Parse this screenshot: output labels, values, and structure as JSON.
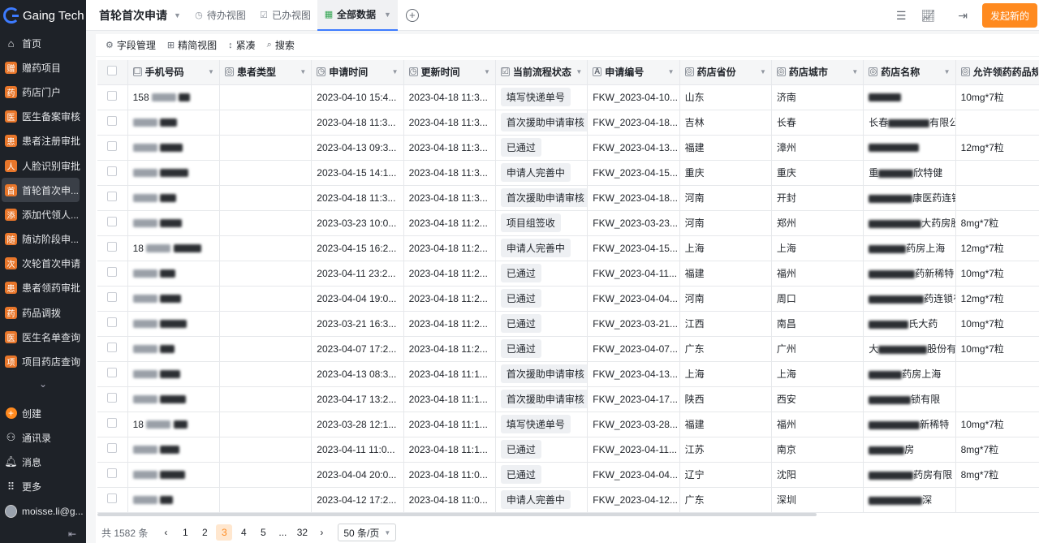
{
  "brand": "Gaing Tech",
  "sidebar": {
    "items": [
      {
        "icon": "home-icon",
        "glyph": "⌂",
        "label": "首页",
        "badge": ""
      },
      {
        "badge": "赠",
        "label": "赠药项目"
      },
      {
        "badge": "药",
        "label": "药店门户"
      },
      {
        "badge": "医",
        "label": "医生备案审核"
      },
      {
        "badge": "患",
        "label": "患者注册审批"
      },
      {
        "badge": "人",
        "label": "人脸识别审批"
      },
      {
        "badge": "首",
        "label": "首轮首次申..."
      },
      {
        "badge": "添",
        "label": "添加代领人..."
      },
      {
        "badge": "随",
        "label": "随访阶段申..."
      },
      {
        "badge": "次",
        "label": "次轮首次申请"
      },
      {
        "badge": "患",
        "label": "患者领药审批"
      },
      {
        "badge": "药",
        "label": "药品调拨"
      },
      {
        "badge": "医",
        "label": "医生名单查询"
      },
      {
        "badge": "项",
        "label": "项目药店查询"
      }
    ],
    "bottom": [
      {
        "name": "create",
        "label": "创建"
      },
      {
        "name": "contacts",
        "label": "通讯录"
      },
      {
        "name": "messages",
        "label": "消息"
      },
      {
        "name": "more",
        "label": "更多"
      },
      {
        "name": "user",
        "label": "moisse.li@g..."
      }
    ]
  },
  "topbar": {
    "title": "首轮首次申请",
    "tabs": [
      {
        "label": "待办视图",
        "glyph": "◷"
      },
      {
        "label": "已办视图",
        "glyph": "☑"
      },
      {
        "label": "全部数据",
        "glyph": "▦"
      }
    ],
    "launch_label": "发起新的"
  },
  "toolbar": {
    "fields": "字段管理",
    "compact_view": "精简视图",
    "dense": "紧凑",
    "search": "搜索"
  },
  "columns": [
    "手机号码",
    "患者类型",
    "申请时间",
    "更新时间",
    "当前流程状态",
    "申请编号",
    "药店省份",
    "药店城市",
    "药店名称",
    "允许领药药品规"
  ],
  "rows": [
    {
      "phone": "158",
      "apply": "2023-04-10 15:4...",
      "update": "2023-04-18 11:3...",
      "status": "填写快递单号",
      "no": "FKW_2023-04-10...",
      "prov": "山东",
      "city": "济南",
      "store": "",
      "spec": "10mg*7粒"
    },
    {
      "phone": "",
      "apply": "2023-04-18 11:3...",
      "update": "2023-04-18 11:3...",
      "status": "首次援助申请审核",
      "no": "FKW_2023-04-18...",
      "prov": "吉林",
      "city": "长春",
      "store": "长春",
      "store_tail": "有限公",
      "spec": ""
    },
    {
      "phone": "",
      "apply": "2023-04-13 09:3...",
      "update": "2023-04-18 11:3...",
      "status": "已通过",
      "no": "FKW_2023-04-13...",
      "prov": "福建",
      "city": "漳州",
      "store": "",
      "spec": "12mg*7粒"
    },
    {
      "phone": "",
      "apply": "2023-04-15 14:1...",
      "update": "2023-04-18 11:3...",
      "status": "申请人完善中",
      "no": "FKW_2023-04-15...",
      "prov": "重庆",
      "city": "重庆",
      "store": "重",
      "store_tail": "欣特健",
      "spec": ""
    },
    {
      "phone": "",
      "apply": "2023-04-18 11:3...",
      "update": "2023-04-18 11:3...",
      "status": "首次援助申请审核",
      "no": "FKW_2023-04-18...",
      "prov": "河南",
      "city": "开封",
      "store": "",
      "store_tail": "康医药连锁",
      "spec": ""
    },
    {
      "phone": "",
      "apply": "2023-03-23 10:0...",
      "update": "2023-04-18 11:2...",
      "status": "项目组签收",
      "no": "FKW_2023-03-23...",
      "prov": "河南",
      "city": "郑州",
      "store": "",
      "store_tail": "大药房股份",
      "spec": "8mg*7粒"
    },
    {
      "phone": "18",
      "apply": "2023-04-15 16:2...",
      "update": "2023-04-18 11:2...",
      "status": "申请人完善中",
      "no": "FKW_2023-04-15...",
      "prov": "上海",
      "city": "上海",
      "store": "",
      "store_tail": "药房上海",
      "spec": "12mg*7粒"
    },
    {
      "phone": "",
      "apply": "2023-04-11 23:2...",
      "update": "2023-04-18 11:2...",
      "status": "已通过",
      "no": "FKW_2023-04-11...",
      "prov": "福建",
      "city": "福州",
      "store": "",
      "store_tail": "药新稀特",
      "spec": "10mg*7粒"
    },
    {
      "phone": "",
      "apply": "2023-04-04 19:0...",
      "update": "2023-04-18 11:2...",
      "status": "已通过",
      "no": "FKW_2023-04-04...",
      "prov": "河南",
      "city": "周口",
      "store": "",
      "store_tail": "药连锁有",
      "spec": "12mg*7粒"
    },
    {
      "phone": "",
      "apply": "2023-03-21 16:3...",
      "update": "2023-04-18 11:2...",
      "status": "已通过",
      "no": "FKW_2023-03-21...",
      "prov": "江西",
      "city": "南昌",
      "store": "",
      "store_tail": "氏大药",
      "spec": "10mg*7粒"
    },
    {
      "phone": "",
      "apply": "2023-04-07 17:2...",
      "update": "2023-04-18 11:2...",
      "status": "已通过",
      "no": "FKW_2023-04-07...",
      "prov": "广东",
      "city": "广州",
      "store": "大",
      "store_tail": "股份有",
      "spec": "10mg*7粒"
    },
    {
      "phone": "",
      "apply": "2023-04-13 08:3...",
      "update": "2023-04-18 11:1...",
      "status": "首次援助申请审核",
      "no": "FKW_2023-04-13...",
      "prov": "上海",
      "city": "上海",
      "store": "",
      "store_tail": "药房上海",
      "spec": ""
    },
    {
      "phone": "",
      "apply": "2023-04-17 13:2...",
      "update": "2023-04-18 11:1...",
      "status": "首次援助申请审核",
      "no": "FKW_2023-04-17...",
      "prov": "陕西",
      "city": "西安",
      "store": "",
      "store_tail": "锁有限",
      "spec": ""
    },
    {
      "phone": "18",
      "apply": "2023-03-28 12:1...",
      "update": "2023-04-18 11:1...",
      "status": "填写快递单号",
      "no": "FKW_2023-03-28...",
      "prov": "福建",
      "city": "福州",
      "store": "",
      "store_tail": "新稀特",
      "spec": "10mg*7粒"
    },
    {
      "phone": "",
      "apply": "2023-04-11 11:0...",
      "update": "2023-04-18 11:1...",
      "status": "已通过",
      "no": "FKW_2023-04-11...",
      "prov": "江苏",
      "city": "南京",
      "store": "",
      "store_tail": "房",
      "spec": "8mg*7粒"
    },
    {
      "phone": "",
      "apply": "2023-04-04 20:0...",
      "update": "2023-04-18 11:0...",
      "status": "已通过",
      "no": "FKW_2023-04-04...",
      "prov": "辽宁",
      "city": "沈阳",
      "store": "",
      "store_tail": "药房有限",
      "spec": "8mg*7粒"
    },
    {
      "phone": "",
      "apply": "2023-04-12 17:2...",
      "update": "2023-04-18 11:0...",
      "status": "申请人完善中",
      "no": "FKW_2023-04-12...",
      "prov": "广东",
      "city": "深圳",
      "store": "",
      "store_tail": "深",
      "spec": ""
    }
  ],
  "pagination": {
    "total": "共 1582 条",
    "pages": [
      "1",
      "2",
      "3",
      "4",
      "5",
      "...",
      "32"
    ],
    "active": "3",
    "page_size": "50 条/页"
  },
  "colors": {
    "accent": "#ff8a1f",
    "sidebar_bg": "#1e2228",
    "badge": "#e8762a",
    "link": "#3d7bff"
  }
}
